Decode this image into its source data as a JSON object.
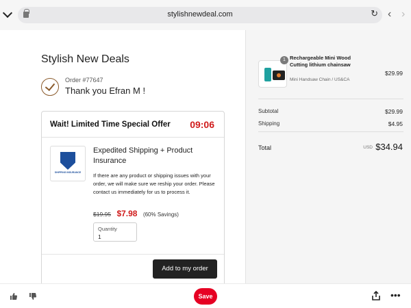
{
  "browser": {
    "url": "stylishnewdeal.com"
  },
  "store": {
    "title": "Stylish New Deals",
    "order_number": "Order #77647",
    "thanks": "Thank you Efran M !"
  },
  "offer": {
    "heading": "Wait! Limited Time Special Offer",
    "timer": "09:06",
    "product_name": "Expedited Shipping + Product Insurance",
    "thumb_label": "SHIPPING INSURANCE",
    "description": "If there are any product or shipping issues with your order, we will make sure we reship your order. Please contact us immediately for us to process it.",
    "old_price": "$19.95",
    "new_price": "$7.98",
    "savings": "(60% Savings)",
    "quantity_label": "Quantity",
    "quantity_value": "1",
    "add_button": "Add to my order"
  },
  "summary": {
    "item_badge": "1",
    "item_name": "Rechargeable Mini Wood Cutting lithium chainsaw",
    "item_variant": "Mini Handsaw Chain / US&CA",
    "item_price": "$29.99",
    "subtotal_label": "Subtotal",
    "subtotal_value": "$29.99",
    "shipping_label": "Shipping",
    "shipping_value": "$4.95",
    "total_label": "Total",
    "total_currency": "USD",
    "total_value": "$34.94"
  },
  "bottom_bar": {
    "save_label": "Save"
  },
  "icons": {
    "lock": "lock-icon",
    "reload": "reload-icon",
    "back": "chevron-left-icon",
    "forward": "chevron-right-icon",
    "check": "checkmark-circle-icon",
    "thumb_up": "thumbs-up-icon",
    "thumb_down": "thumbs-down-icon",
    "share": "share-icon",
    "more": "more-options-icon"
  },
  "colors": {
    "accent_red": "#d01b1b",
    "save_red": "#e60023",
    "button_dark": "#222222"
  }
}
